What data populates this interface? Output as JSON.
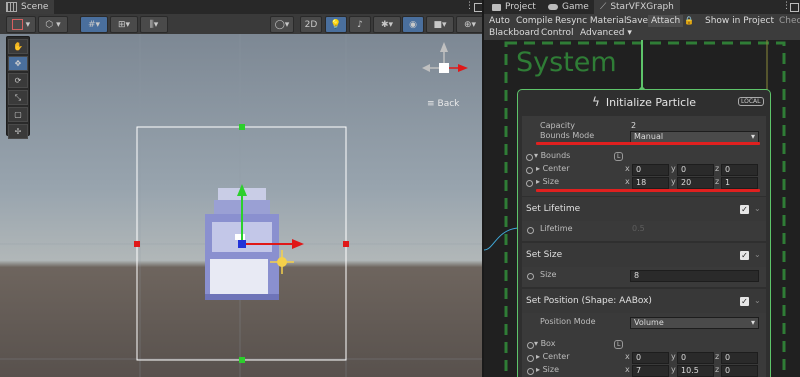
{
  "scene": {
    "tabs": [
      {
        "label": "Scene",
        "icon": "grid-icon"
      }
    ],
    "toolbar": {
      "mode_2d": "2D"
    },
    "back_label": "Back"
  },
  "graph": {
    "tabs": [
      {
        "label": "Project"
      },
      {
        "label": "Game"
      },
      {
        "label": "StarVFXGraph"
      }
    ],
    "toolbar": {
      "auto": "Auto",
      "compile": "Compile",
      "resync": "Resync Material",
      "save": "Save",
      "attach": "Attach",
      "show_in_project": "Show in Project",
      "check": "Chec",
      "blackboard": "Blackboard",
      "control": "Control",
      "advanced": "Advanced ▾"
    },
    "system_title": "System",
    "node": {
      "title": "Initialize Particle",
      "badge": "LOCAL",
      "capacity_label": "Capacity",
      "capacity_value": "2",
      "bounds_mode_label": "Bounds Mode",
      "bounds_mode_value": "Manual",
      "bounds_label": "Bounds",
      "bounds_badge": "L",
      "center_label": "Center",
      "center": {
        "x": "0",
        "y": "0",
        "z": "0"
      },
      "size_label": "Size",
      "size": {
        "x": "18",
        "y": "20",
        "z": "1"
      }
    },
    "blocks": {
      "set_lifetime": {
        "title": "Set Lifetime",
        "field": "Lifetime",
        "value": "0.5"
      },
      "set_size": {
        "title": "Set Size",
        "field": "Size",
        "value": "8"
      },
      "set_position": {
        "title": "Set Position (Shape: AABox)",
        "mode_label": "Position Mode",
        "mode_value": "Volume",
        "box_label": "Box",
        "box_badge": "L",
        "center_label": "Center",
        "center": {
          "x": "0",
          "y": "0",
          "z": "0"
        },
        "size_label": "Size",
        "size": {
          "x": "7",
          "y": "10.5",
          "z": "0"
        }
      }
    },
    "axis_labels": {
      "x": "x",
      "y": "y",
      "z": "z"
    },
    "colors": {
      "system_border": "#2f7d36",
      "node_border": "#5ec46a",
      "highlight": "#e0201f"
    }
  }
}
